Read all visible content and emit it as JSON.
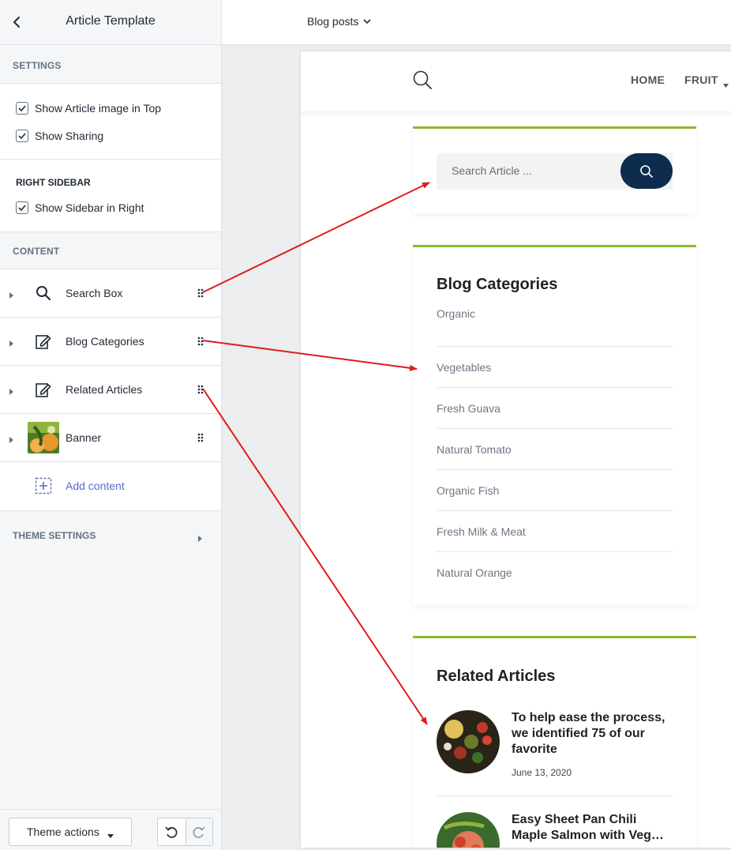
{
  "sidebar": {
    "title": "Article Template",
    "sections": {
      "settings": "SETTINGS",
      "right_sidebar": "RIGHT SIDEBAR",
      "content": "CONTENT",
      "theme_settings": "THEME SETTINGS"
    },
    "settings": {
      "show_image_top": "Show Article image in Top",
      "show_sharing": "Show Sharing"
    },
    "right_sidebar": {
      "show_sidebar_right": "Show Sidebar in Right"
    },
    "content_items": [
      {
        "label": "Search Box",
        "icon": "search-icon"
      },
      {
        "label": "Blog Categories",
        "icon": "edit-icon"
      },
      {
        "label": "Related Articles",
        "icon": "edit-icon"
      },
      {
        "label": "Banner",
        "icon": "banner-thumbnail"
      }
    ],
    "add_content": "Add content",
    "footer": {
      "theme_actions": "Theme actions"
    }
  },
  "topbar": {
    "page_selector": "Blog posts"
  },
  "preview": {
    "nav": {
      "home": "HOME",
      "fruit": "FRUIT"
    },
    "search": {
      "placeholder": "Search Article ..."
    },
    "categories": {
      "title": "Blog Categories",
      "items": [
        "Organic",
        "Vegetables",
        "Fresh Guava",
        "Natural Tomato",
        "Organic Fish",
        "Fresh Milk & Meat",
        "Natural Orange"
      ]
    },
    "related": {
      "title": "Related Articles",
      "articles": [
        {
          "title": "To help ease the process, we identified 75 of our favorite",
          "date": "June 13, 2020"
        },
        {
          "title": "Easy Sheet Pan Chili Maple Salmon with Veg…",
          "date": ""
        }
      ]
    }
  },
  "colors": {
    "accent_green": "#8db92e",
    "navy_button": "#0d2c4e",
    "annotation_red": "#e01b1b",
    "link_purple": "#5c6ac4"
  }
}
